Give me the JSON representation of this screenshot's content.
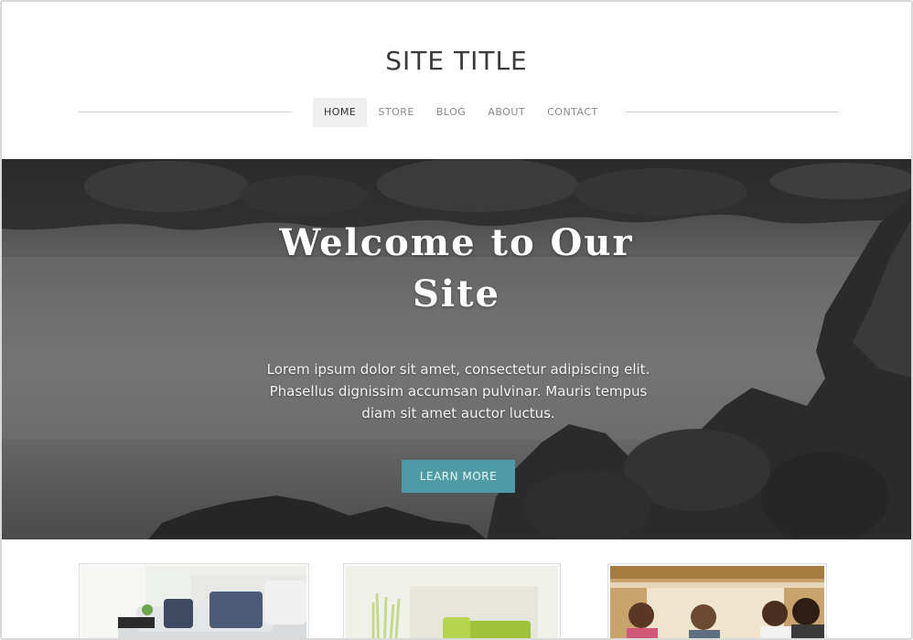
{
  "header": {
    "site_title": "SITE TITLE",
    "nav": [
      {
        "label": "HOME",
        "active": true
      },
      {
        "label": "STORE",
        "active": false
      },
      {
        "label": "BLOG",
        "active": false
      },
      {
        "label": "ABOUT",
        "active": false
      },
      {
        "label": "CONTACT",
        "active": false
      }
    ]
  },
  "hero": {
    "title_line1": "Welcome to Our",
    "title_line2": "Site",
    "text_line1": "Lorem ipsum dolor sit amet, consectetur adipiscing elit.",
    "text_line2": "Phasellus dignissim accumsan pulvinar. Mauris tempus",
    "text_line3": "diam sit amet auctor luctus.",
    "button_label": "LEARN MORE"
  },
  "features": {
    "cards": [
      {
        "image": "living-room-sofa-photo"
      },
      {
        "image": "green-chair-interior-photo"
      },
      {
        "image": "smiling-people-group-photo"
      }
    ]
  },
  "colors": {
    "accent": "#4e9aa5",
    "nav_active_bg": "#efefef",
    "title": "#3a3a3a"
  }
}
